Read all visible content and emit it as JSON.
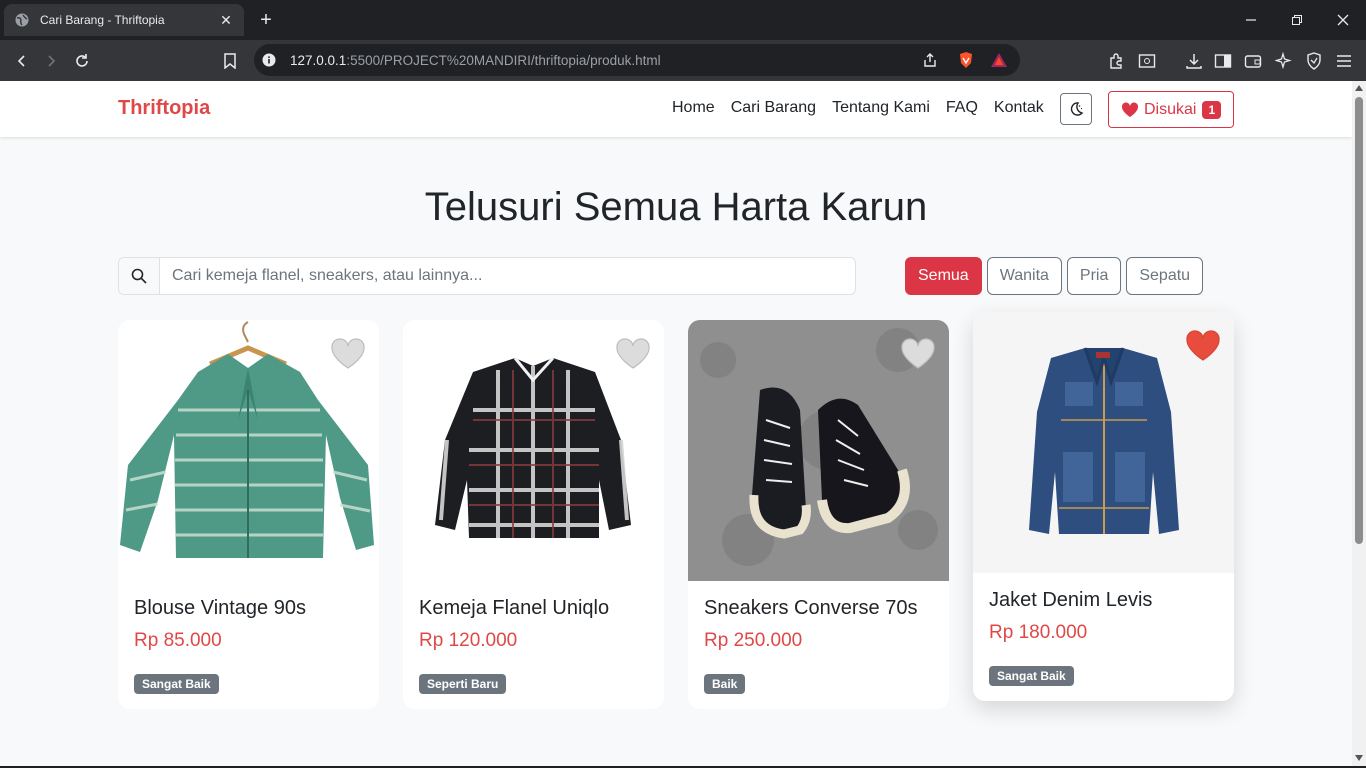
{
  "browser": {
    "tab_title": "Cari Barang - Thriftopia",
    "url_host": "127.0.0.1",
    "url_path": ":5500/PROJECT%20MANDIRI/thriftopia/produk.html"
  },
  "navbar": {
    "brand": "Thriftopia",
    "links": [
      "Home",
      "Cari Barang",
      "Tentang Kami",
      "FAQ",
      "Kontak"
    ],
    "liked_label": "Disukai",
    "liked_count": "1"
  },
  "page": {
    "heading": "Telusuri Semua Harta Karun",
    "search_placeholder": "Cari kemeja flanel, sneakers, atau lainnya...",
    "filters": [
      "Semua",
      "Wanita",
      "Pria",
      "Sepatu"
    ],
    "active_filter": "Semua"
  },
  "products": [
    {
      "name": "Blouse Vintage 90s",
      "price": "Rp 85.000",
      "condition": "Sangat Baik",
      "liked": false
    },
    {
      "name": "Kemeja Flanel Uniqlo",
      "price": "Rp 120.000",
      "condition": "Seperti Baru",
      "liked": false
    },
    {
      "name": "Sneakers Converse 70s",
      "price": "Rp 250.000",
      "condition": "Baik",
      "liked": false
    },
    {
      "name": "Jaket Denim Levis",
      "price": "Rp 180.000",
      "condition": "Sangat Baik",
      "liked": true
    }
  ],
  "colors": {
    "brand": "#e04848",
    "accent": "#dc3545",
    "badge": "#6c757d",
    "liked_heart": "#e74c3c"
  }
}
